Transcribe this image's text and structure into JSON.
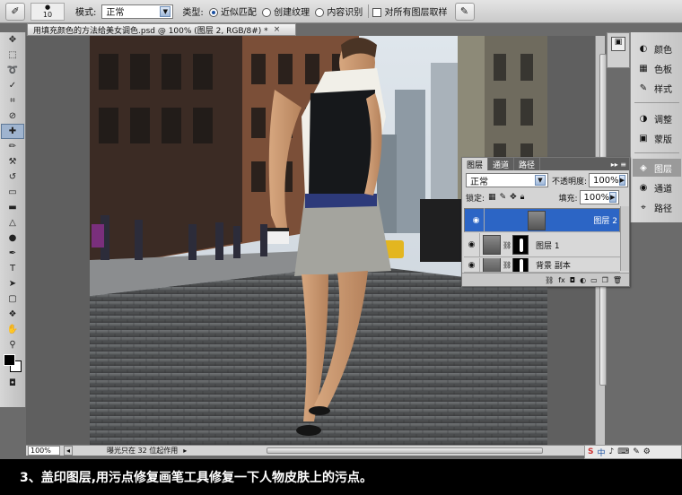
{
  "options_bar": {
    "brush_size": "10",
    "mode_label": "模式:",
    "mode_value": "正常",
    "type_label": "类型:",
    "type_options": [
      {
        "label": "近似匹配",
        "selected": true
      },
      {
        "label": "创建纹理",
        "selected": false
      },
      {
        "label": "内容识别",
        "selected": false
      }
    ],
    "sample_all_label": "对所有图层取样"
  },
  "document": {
    "tab_title": "用填充颜色的方法给美女调色.psd @ 100% (图层 2, RGB/8#) *",
    "close_glyph": "×"
  },
  "status": {
    "zoom": "100%",
    "info": "曝光只在 32 位起作用"
  },
  "dock": {
    "items": [
      {
        "label": "颜色",
        "icon": "color-icon",
        "glyph": "◐"
      },
      {
        "label": "色板",
        "icon": "swatches-icon",
        "glyph": "▦"
      },
      {
        "label": "样式",
        "icon": "styles-icon",
        "glyph": "✎"
      },
      {
        "label": "调整",
        "icon": "adjustments-icon",
        "glyph": "◑"
      },
      {
        "label": "蒙版",
        "icon": "masks-icon",
        "glyph": "▣"
      },
      {
        "label": "图层",
        "icon": "layers-icon",
        "glyph": "◈"
      },
      {
        "label": "通道",
        "icon": "channels-icon",
        "glyph": "◉"
      },
      {
        "label": "路径",
        "icon": "paths-icon",
        "glyph": "⌖"
      }
    ],
    "active": "图层"
  },
  "layers_panel": {
    "tabs": [
      "图层",
      "通道",
      "路径"
    ],
    "blend_mode": "正常",
    "opacity_label": "不透明度:",
    "opacity_value": "100%",
    "lock_label": "锁定:",
    "fill_label": "填充:",
    "fill_value": "100%",
    "layers": [
      {
        "name": "图层 2",
        "selected": true,
        "has_mask": false
      },
      {
        "name": "图层 1",
        "selected": false,
        "has_mask": true
      },
      {
        "name": "背景 副本",
        "selected": false,
        "has_mask": true
      }
    ]
  },
  "tray": {
    "items": [
      "S",
      "中",
      "♪",
      "⌨",
      "✎",
      "⚙"
    ]
  },
  "caption": "3、盖印图层,用污点修复画笔工具修复一下人物皮肤上的污点。",
  "colors": {
    "workspace": "#6b6b6b",
    "selection_blue": "#2c65c5",
    "panel_grey": "#d4d4d4"
  }
}
